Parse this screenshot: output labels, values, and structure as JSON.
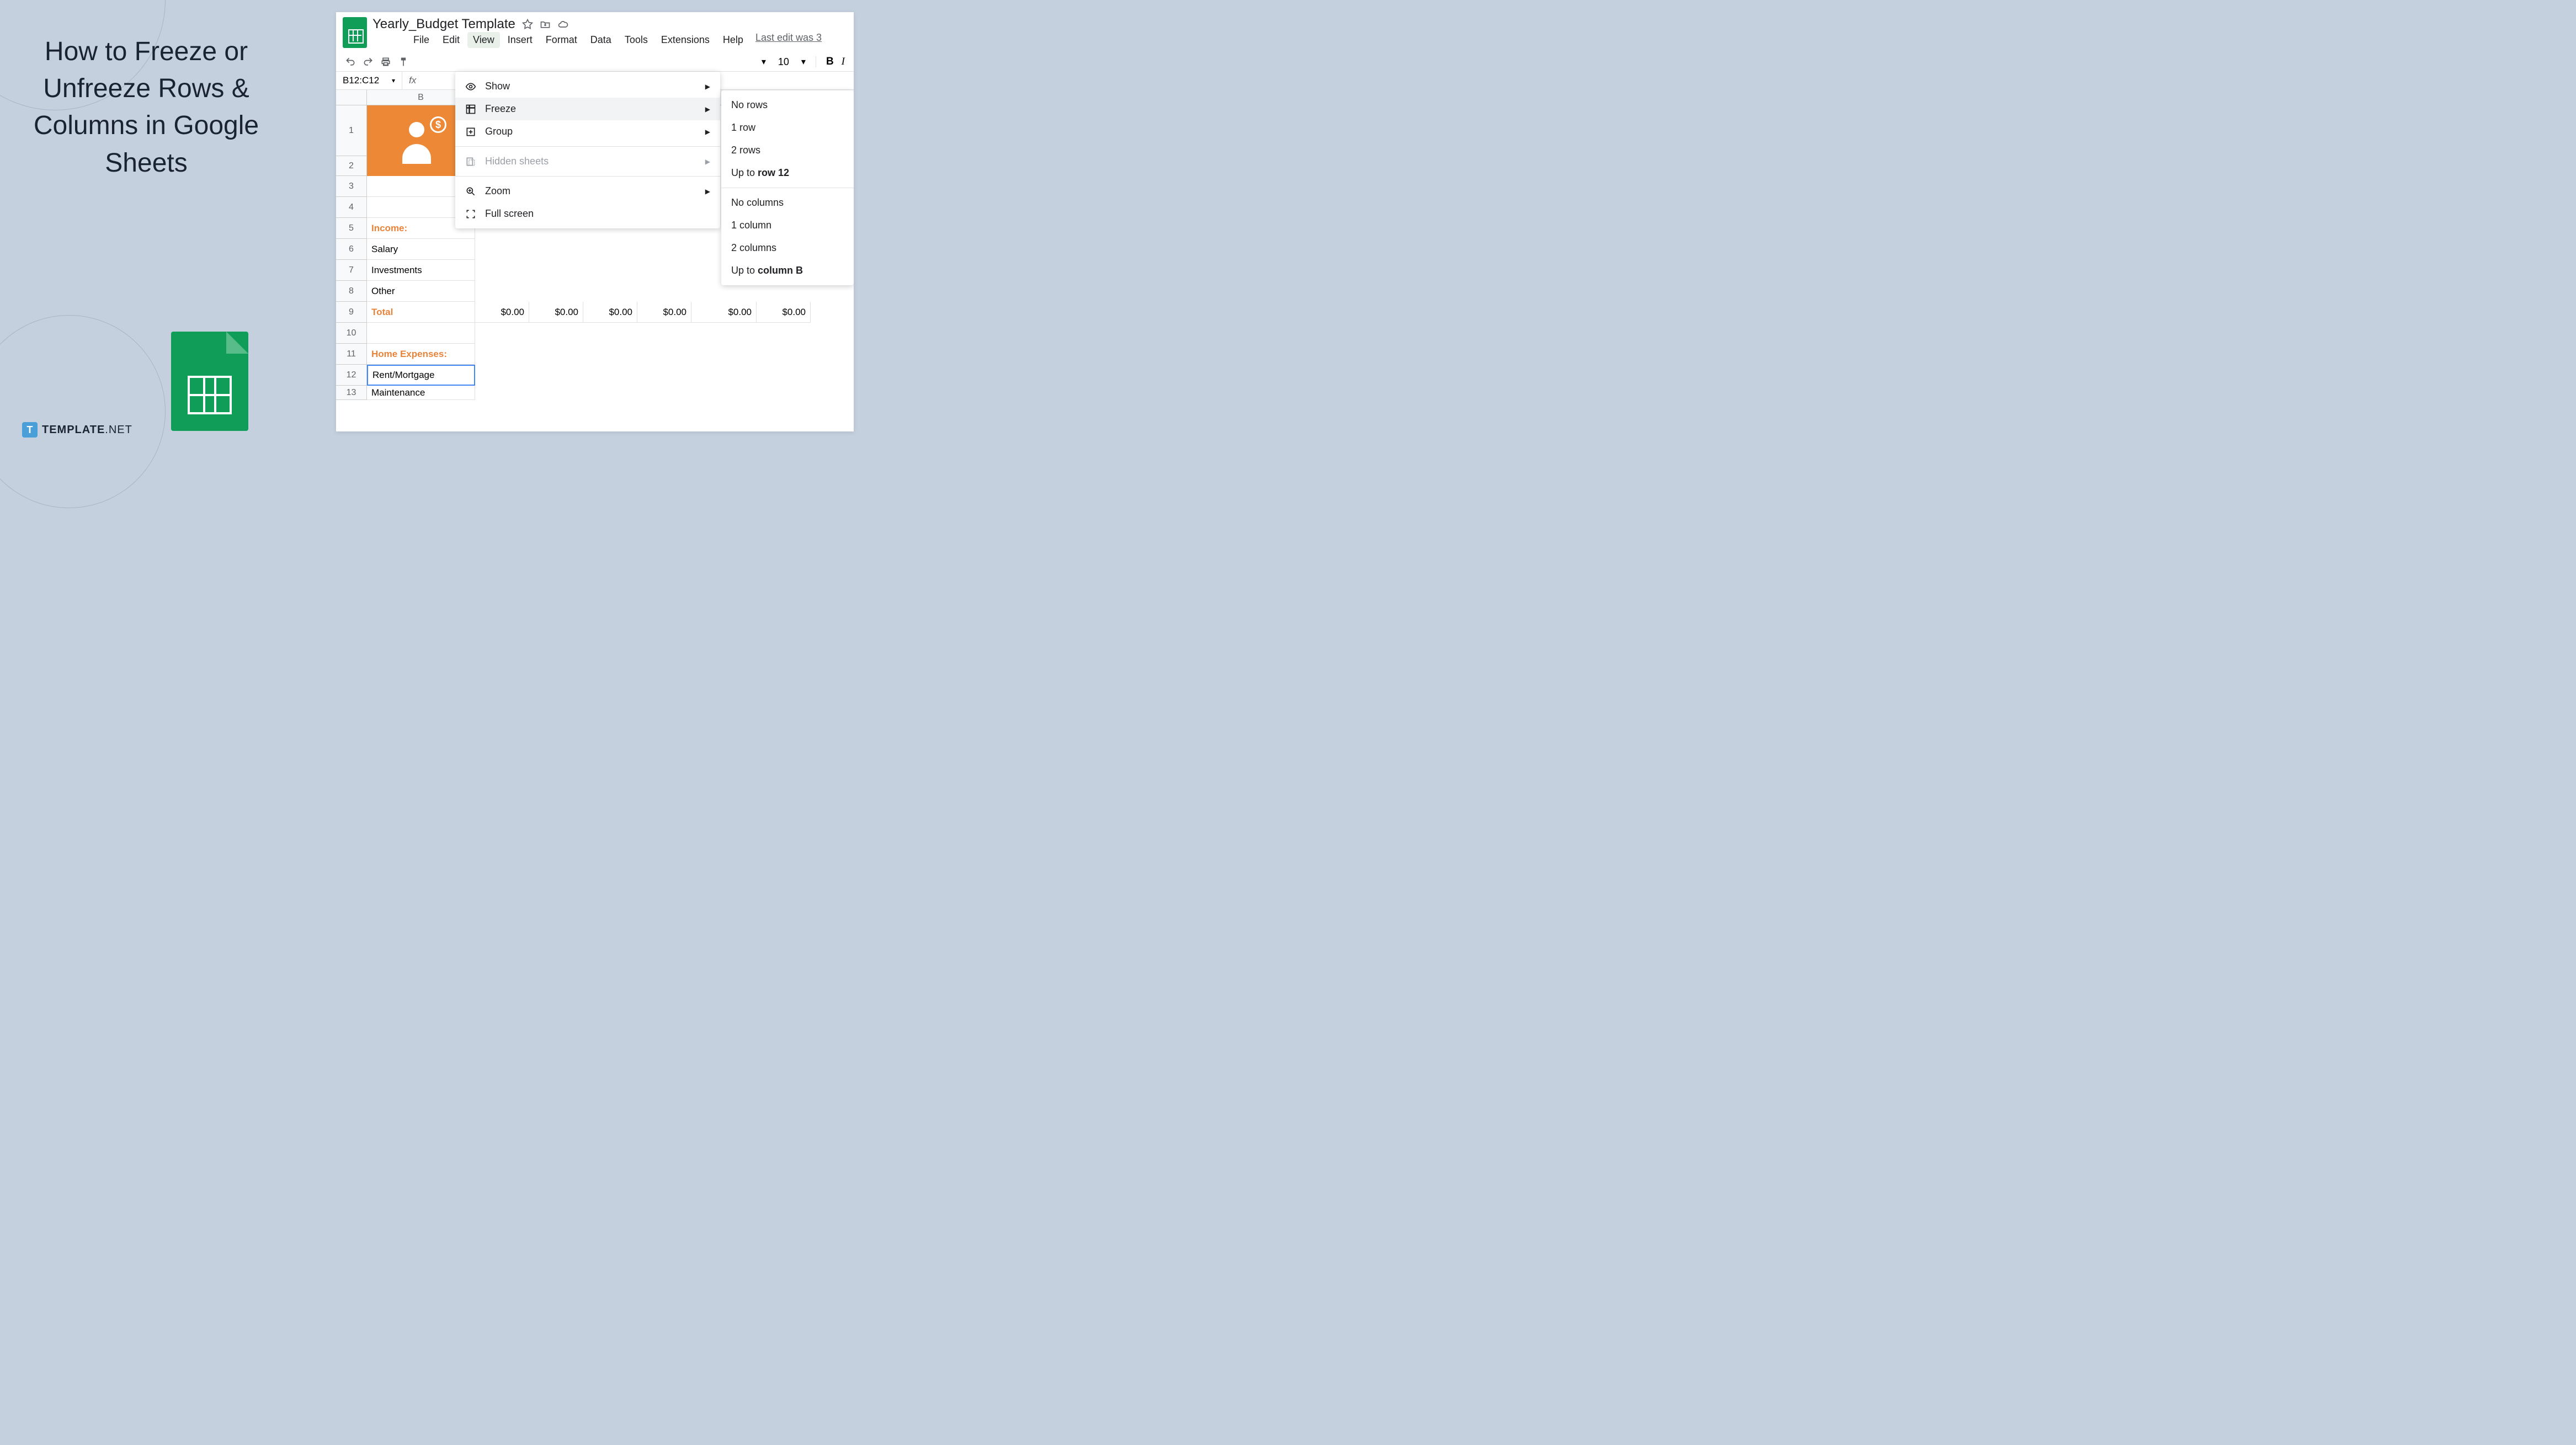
{
  "tutorial": {
    "title": "How to Freeze or Unfreeze Rows & Columns in Google Sheets"
  },
  "template_logo": {
    "letter": "T",
    "brand": "TEMPLATE",
    "tld": ".NET"
  },
  "app": {
    "doc_title": "Yearly_Budget Template",
    "menu": {
      "file": "File",
      "edit": "Edit",
      "view": "View",
      "insert": "Insert",
      "format": "Format",
      "data": "Data",
      "tools": "Tools",
      "extensions": "Extensions",
      "help": "Help",
      "last_edit": "Last edit was 3"
    },
    "toolbar": {
      "font_size": "10",
      "bold": "B",
      "italic": "I"
    },
    "name_box": "B12:C12",
    "fx": "fx",
    "columns": [
      "B"
    ],
    "rows": [
      "1",
      "2",
      "3",
      "4",
      "5",
      "6",
      "7",
      "8",
      "9",
      "10",
      "11",
      "12",
      "13"
    ],
    "cells": {
      "income": "Income:",
      "salary": "Salary",
      "investments": "Investments",
      "other": "Other",
      "total": "Total",
      "money": "$0.00",
      "home_expenses": "Home Expenses:",
      "rent": "Rent/Mortgage",
      "maintenance": "Maintenance"
    },
    "view_menu": {
      "show": "Show",
      "freeze": "Freeze",
      "group": "Group",
      "hidden": "Hidden sheets",
      "zoom": "Zoom",
      "fullscreen": "Full screen"
    },
    "freeze_submenu": {
      "no_rows": "No rows",
      "one_row": "1 row",
      "two_rows": "2 rows",
      "up_to_row_prefix": "Up to ",
      "up_to_row_bold": "row 12",
      "no_cols": "No columns",
      "one_col": "1 column",
      "two_cols": "2 columns",
      "up_to_col_prefix": "Up to ",
      "up_to_col_bold": "column B"
    }
  }
}
